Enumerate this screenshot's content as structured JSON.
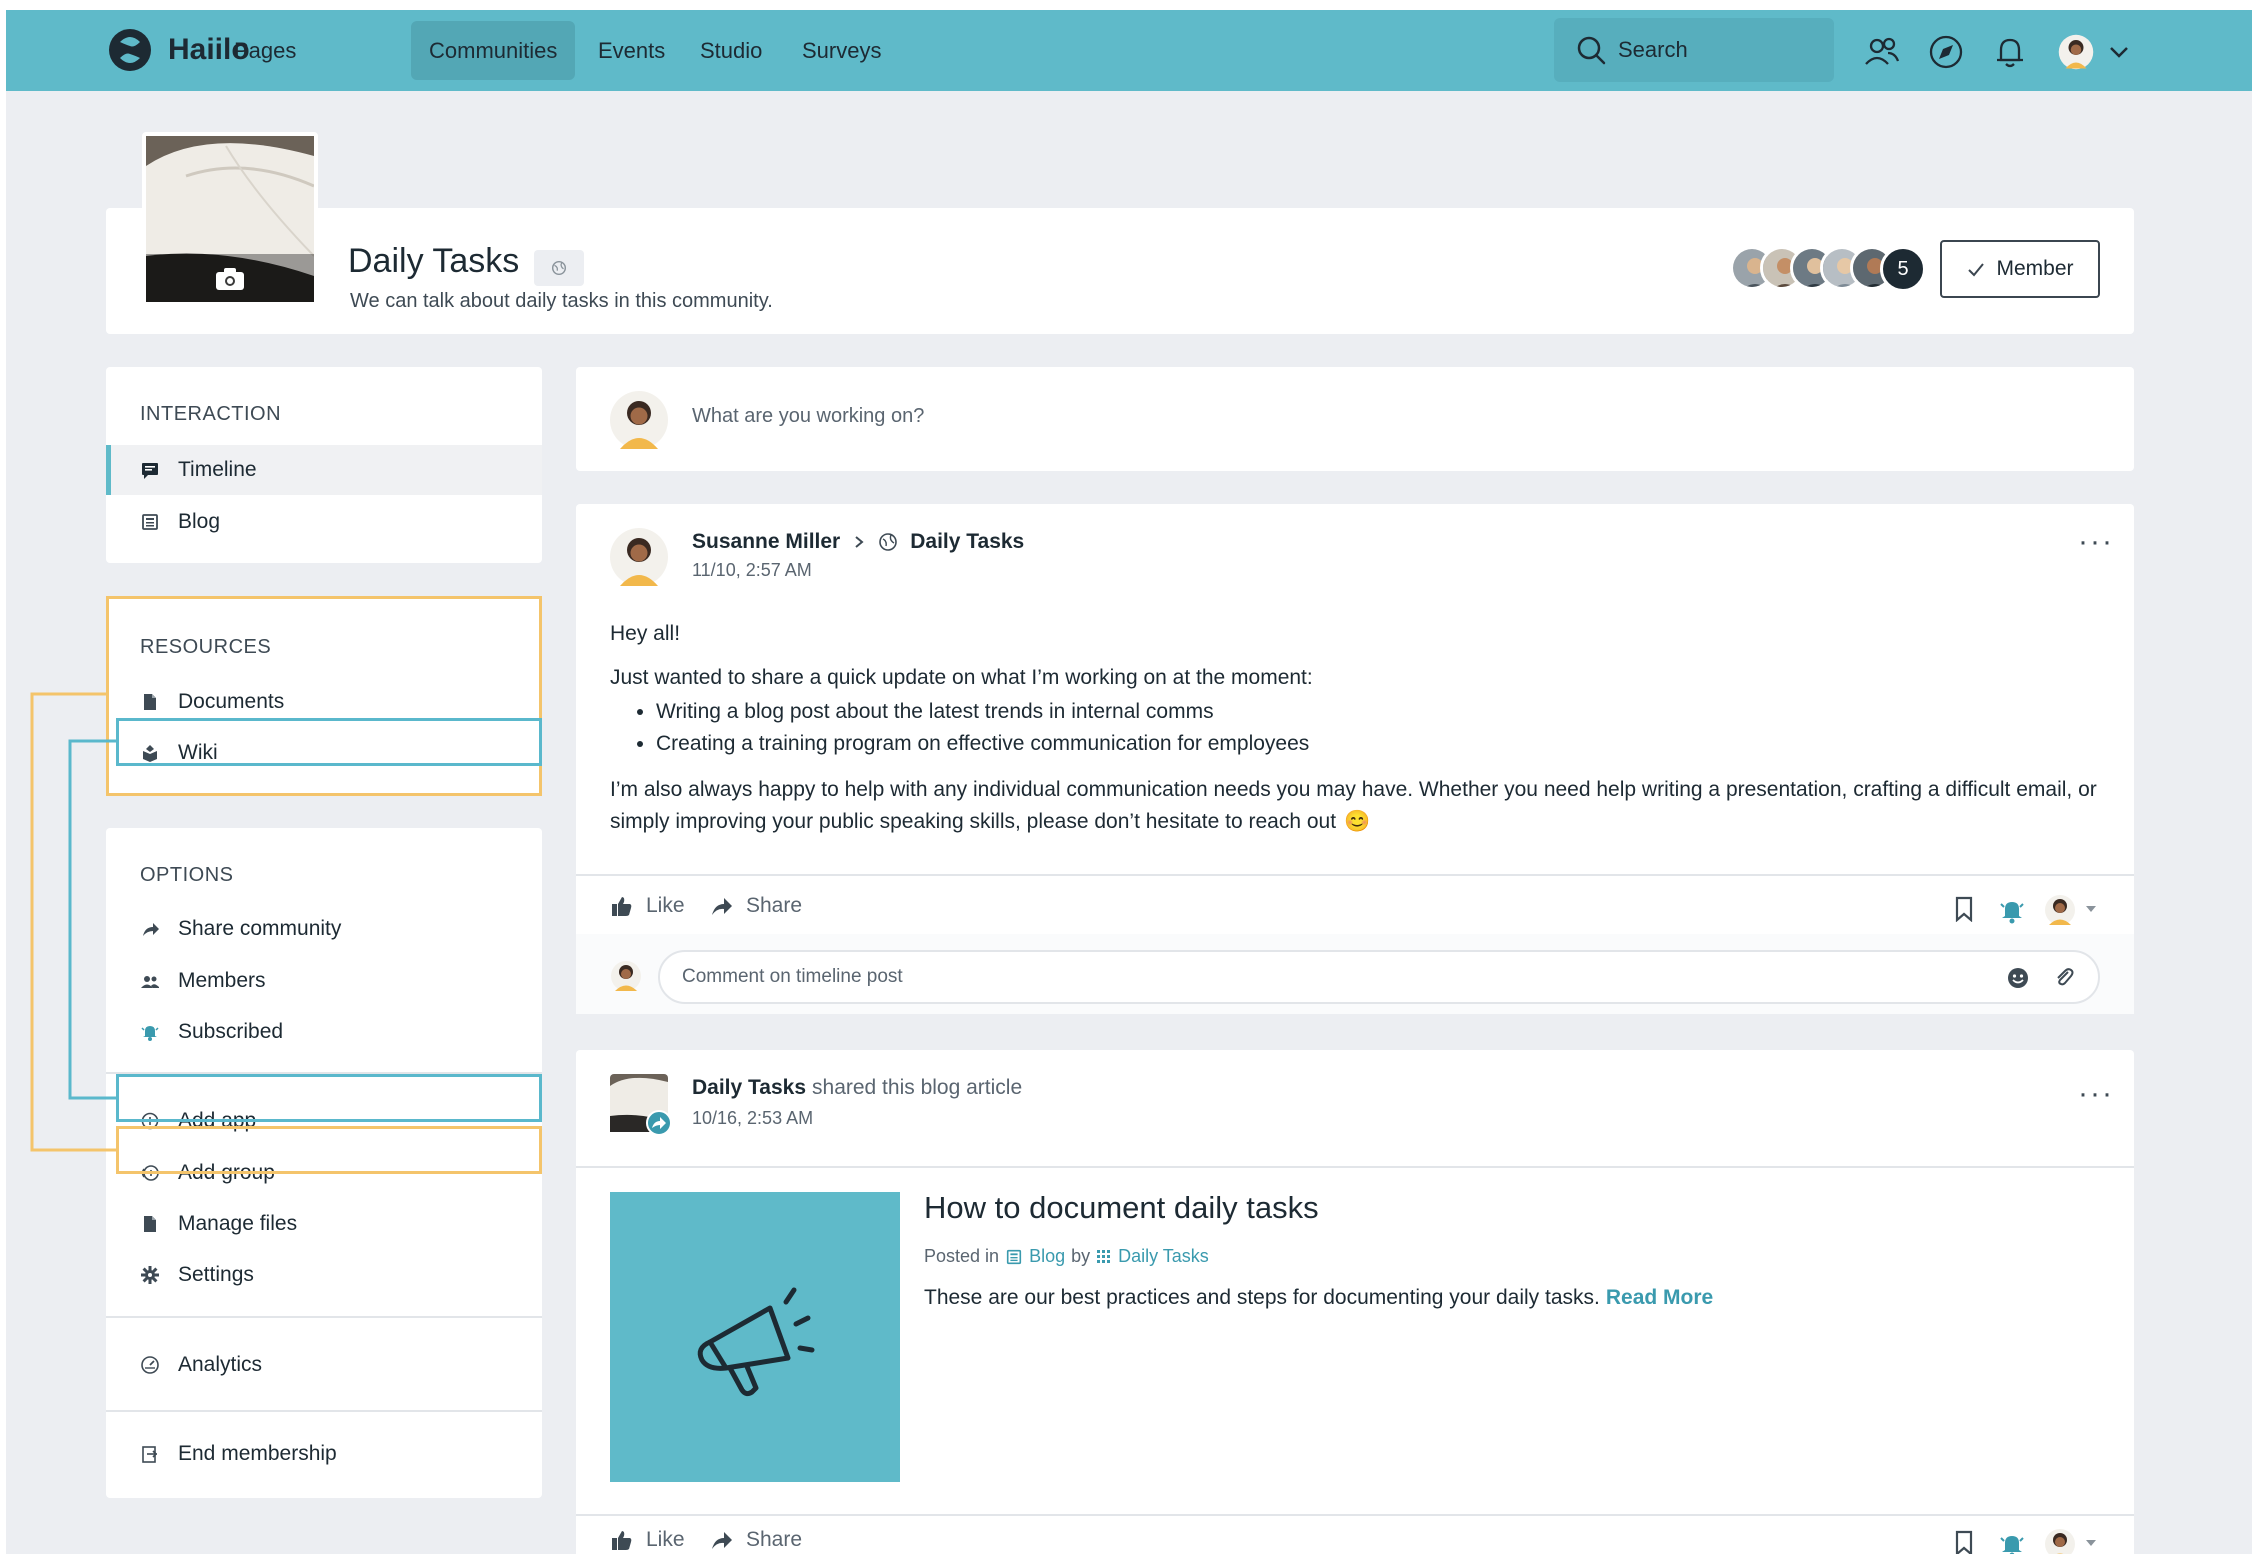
{
  "nav": {
    "brand": "Haiilo",
    "items": [
      "Pages",
      "Communities",
      "Events",
      "Studio",
      "Surveys"
    ],
    "active": "Communities",
    "search_label": "Search"
  },
  "community": {
    "title": "Daily Tasks",
    "description": "We can talk about daily tasks in this community.",
    "member_count": "5",
    "member_button": "Member"
  },
  "sidebar": {
    "interaction": {
      "heading": "INTERACTION",
      "items": [
        {
          "label": "Timeline",
          "icon": "timeline-icon"
        },
        {
          "label": "Blog",
          "icon": "blog-icon"
        }
      ]
    },
    "resources": {
      "heading": "RESOURCES",
      "items": [
        {
          "label": "Documents",
          "icon": "document-icon"
        },
        {
          "label": "Wiki",
          "icon": "wiki-icon"
        }
      ]
    },
    "options": {
      "heading": "OPTIONS",
      "items": [
        {
          "label": "Share community",
          "icon": "share-icon"
        },
        {
          "label": "Members",
          "icon": "members-icon"
        },
        {
          "label": "Subscribed",
          "icon": "bell-icon"
        },
        {
          "label": "Add app",
          "icon": "add-app-icon"
        },
        {
          "label": "Add group",
          "icon": "add-group-icon"
        },
        {
          "label": "Manage files",
          "icon": "file-icon"
        },
        {
          "label": "Settings",
          "icon": "gear-icon"
        }
      ]
    },
    "analytics": "Analytics",
    "end_membership": "End membership"
  },
  "composer": {
    "placeholder": "What are you working on?"
  },
  "post1": {
    "author": "Susanne Miller",
    "target": "Daily Tasks",
    "time": "11/10, 2:57 AM",
    "greeting": "Hey all!",
    "intro": "Just wanted to share a quick update on what I’m working on at the moment:",
    "bullets": [
      "Writing a blog post about the latest trends in internal comms",
      "Creating a training program on effective communication for employees"
    ],
    "closing_line1": "I’m also always happy to help with any individual communication needs you may have. Whether you need help writing a presentation, crafting a difficult email, or",
    "closing_line2": "simply improving your public speaking skills, please don’t hesitate to reach out",
    "emoji": "😊",
    "like": "Like",
    "share": "Share",
    "comment_placeholder": "Comment on timeline post"
  },
  "post2": {
    "author": "Daily Tasks",
    "action_text": "shared this blog article",
    "time": "10/16, 2:53 AM",
    "article_title": "How to document daily tasks",
    "posted_in": "Posted in",
    "blog_link": "Blog",
    "by": "by",
    "community_link": "Daily Tasks",
    "teaser": "These are our best practices and steps for documenting your daily tasks.",
    "read_more": "Read More",
    "like": "Like",
    "share": "Share"
  },
  "colors": {
    "nav_bg": "#5fbac9",
    "page_bg": "#eceef2",
    "highlight_orange": "#f4c46b",
    "highlight_blue": "#5ab8cc",
    "article_image_bg": "#5fbac9"
  }
}
